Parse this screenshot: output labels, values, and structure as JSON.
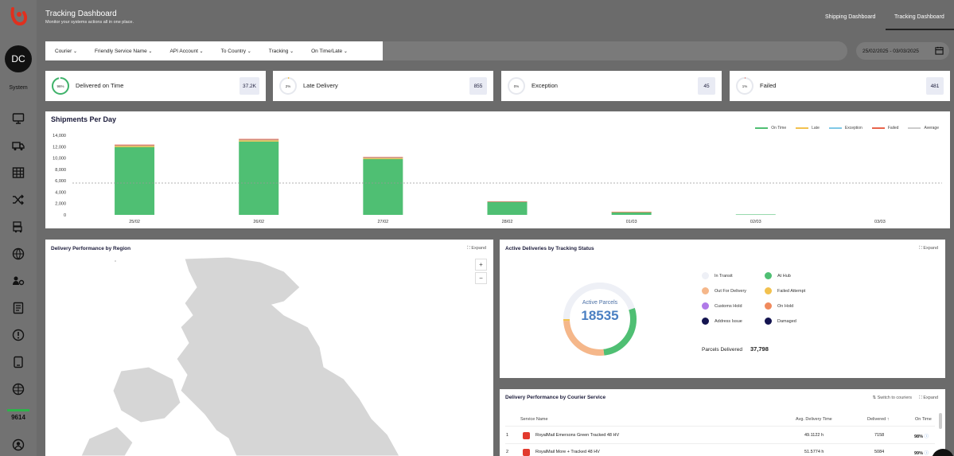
{
  "sidebar": {
    "avatar_initials": "DC",
    "avatar_label": "System",
    "icons": [
      "monitor-icon",
      "truck-icon",
      "table-icon",
      "shuffle-icon",
      "truck-stack-icon",
      "globe-icon",
      "users-gear-icon",
      "book-icon",
      "alert-icon",
      "tablet-icon",
      "globe-grid-icon"
    ],
    "count": "9614"
  },
  "header": {
    "title": "Tracking Dashboard",
    "subtitle": "Monitor your systems actions all in one place.",
    "tabs": [
      {
        "label": "Shipping Dashboard"
      },
      {
        "label": "Tracking Dashboard"
      }
    ]
  },
  "filters": [
    "Courier",
    "Friendly Service Name",
    "API Account",
    "To Country",
    "Tracking",
    "On Time/Late"
  ],
  "date_range": "25/02/2025 - 03/03/2025",
  "kpis": [
    {
      "ring": "96%",
      "label": "Delivered on Time",
      "value": "37.2K",
      "pct": 0.96,
      "color": "#3fb36a"
    },
    {
      "ring": "2%",
      "label": "Late Delivery",
      "value": "855",
      "pct": 0.02,
      "color": "#f2c14e"
    },
    {
      "ring": "0%",
      "label": "Exception",
      "value": "45",
      "pct": 0.0,
      "color": "#7fc8e6"
    },
    {
      "ring": "1%",
      "label": "Failed",
      "value": "481",
      "pct": 0.01,
      "color": "#e8644b"
    }
  ],
  "shipments": {
    "title": "Shipments Per Day",
    "legend": [
      {
        "name": "On Time",
        "color": "#4fbf73"
      },
      {
        "name": "Late",
        "color": "#f2c14e"
      },
      {
        "name": "Exception",
        "color": "#7fc8e6"
      },
      {
        "name": "Failed",
        "color": "#e8644b"
      },
      {
        "name": "Average",
        "color": "#cccccc"
      }
    ]
  },
  "chart_data": {
    "type": "bar",
    "title": "Shipments Per Day",
    "categories": [
      "25/02",
      "26/02",
      "27/02",
      "28/02",
      "01/03",
      "02/03",
      "03/03"
    ],
    "series": [
      {
        "name": "On Time",
        "values": [
          11900,
          12900,
          9800,
          2300,
          500,
          80,
          0
        ]
      },
      {
        "name": "Late",
        "values": [
          300,
          300,
          250,
          50,
          10,
          0,
          0
        ]
      },
      {
        "name": "Exception",
        "values": [
          10,
          10,
          10,
          5,
          0,
          0,
          0
        ]
      },
      {
        "name": "Failed",
        "values": [
          150,
          150,
          120,
          30,
          5,
          0,
          0
        ]
      }
    ],
    "average": 5600,
    "y_ticks": [
      "0",
      "2,000",
      "4,000",
      "6,000",
      "8,000",
      "10,000",
      "12,000",
      "14,000"
    ],
    "ylim": [
      0,
      14000
    ],
    "legend_position": "top-right"
  },
  "map": {
    "title": "Delivery Performance by Region",
    "expand": "Expand",
    "zoom_in": "+",
    "zoom_out": "−"
  },
  "active": {
    "title": "Active Deliveries by Tracking Status",
    "expand": "Expand",
    "center_label": "Active Parcels",
    "center_value": "18535",
    "statuses": [
      {
        "label": "In Transit",
        "color": "#eef0f6"
      },
      {
        "label": "At Hub",
        "color": "#4fbf73"
      },
      {
        "label": "Out For Delivery",
        "color": "#f5b78a"
      },
      {
        "label": "Failed Attempt",
        "color": "#f2c14e"
      },
      {
        "label": "Customs Hold",
        "color": "#b07ae8"
      },
      {
        "label": "On Hold",
        "color": "#f08a5d"
      },
      {
        "label": "Address Issue",
        "color": "#141450"
      },
      {
        "label": "Damaged",
        "color": "#141450"
      }
    ],
    "segments": [
      0.45,
      0.28,
      0.26,
      0.01
    ],
    "parcels_label": "Parcels Delivered",
    "parcels_value": "37,798"
  },
  "courier_table": {
    "title": "Delivery Performance by Courier Service",
    "switch_label": "Switch to couriers",
    "expand": "Expand",
    "columns": [
      "Service Name",
      "Avg. Delivery Time",
      "Delivered",
      "On Time"
    ],
    "sort_indicator": "↑",
    "rows": [
      {
        "rank": "1",
        "name": "RoyalMail Emersons Green Tracked 48 HV",
        "avg": "49.1122 h",
        "delivered": "7158",
        "ontime": "98%"
      },
      {
        "rank": "2",
        "name": "RoyalMail More + Tracked 48 HV",
        "avg": "51.5774 h",
        "delivered": "5084",
        "ontime": "99%"
      }
    ]
  }
}
